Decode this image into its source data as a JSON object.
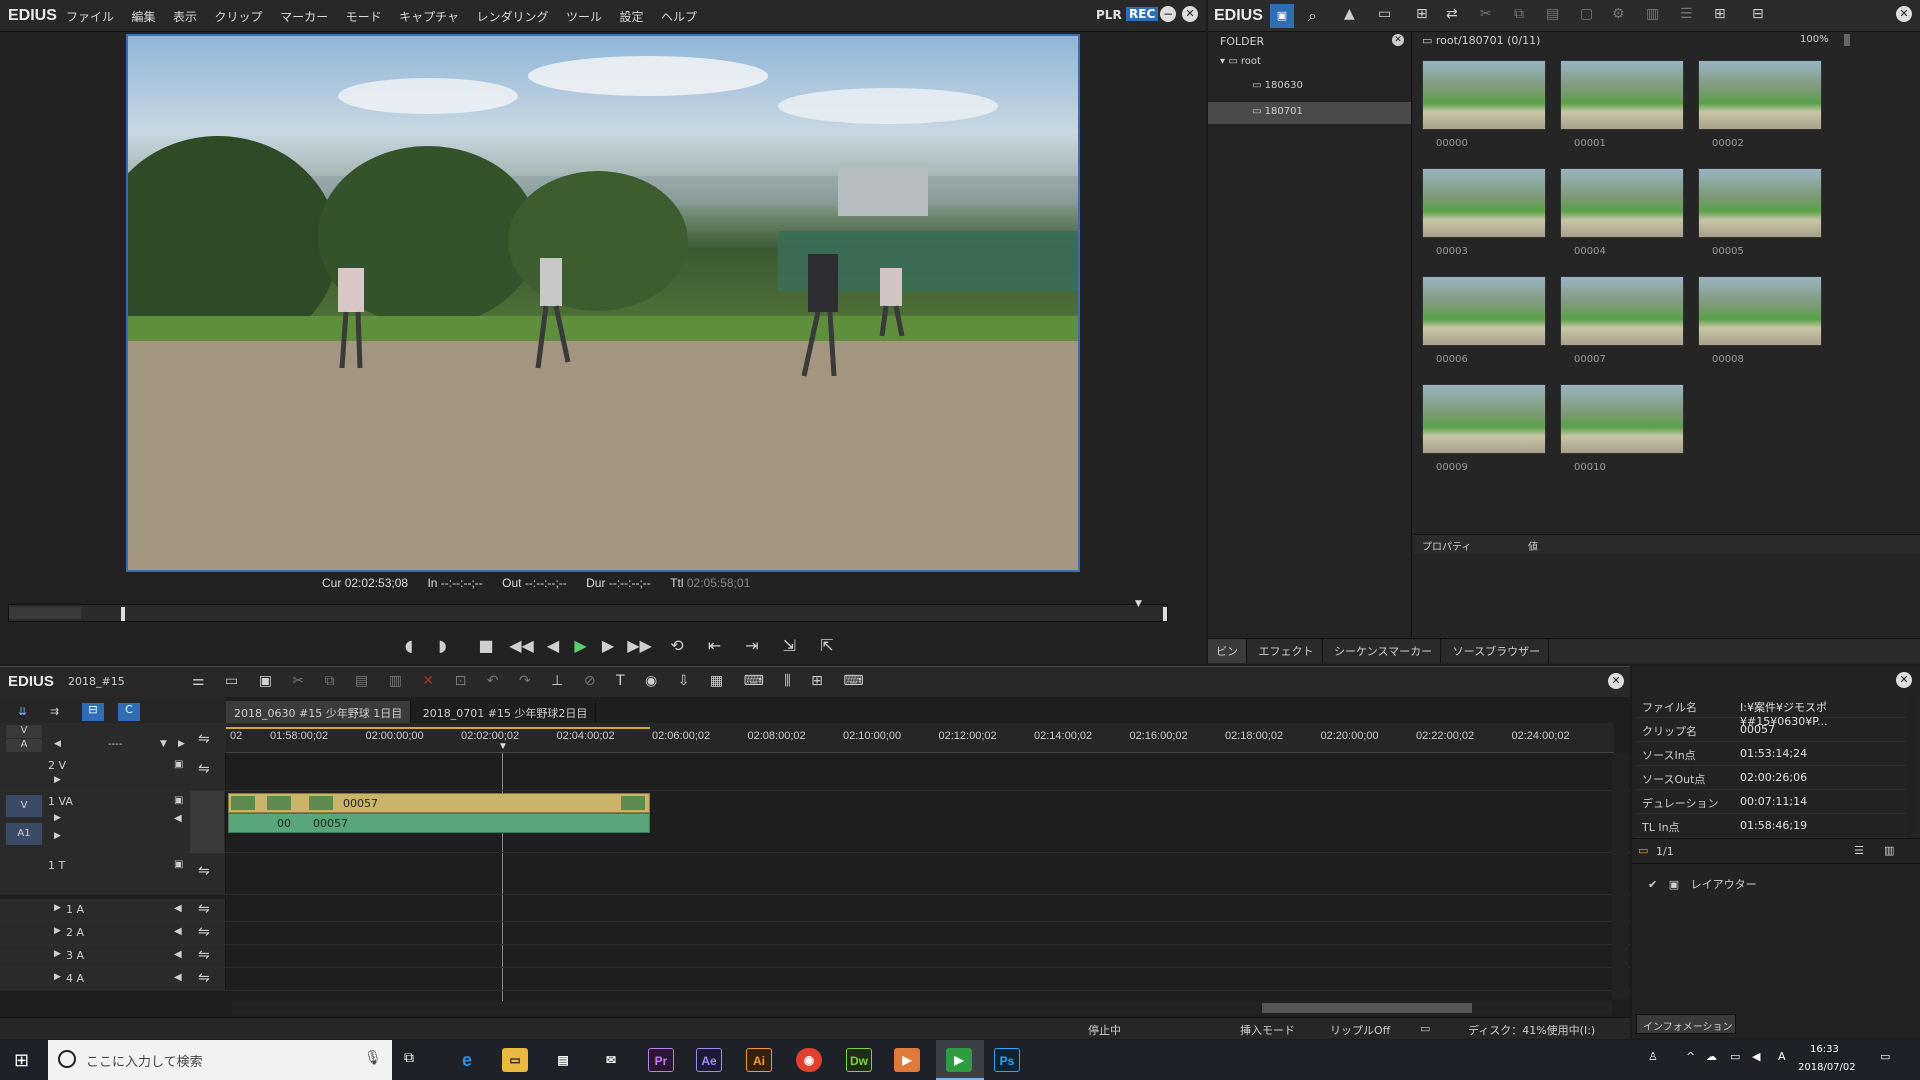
{
  "player": {
    "logo": "EDIUS",
    "menu": [
      "ファイル",
      "編集",
      "表示",
      "クリップ",
      "マーカー",
      "モード",
      "キャプチャ",
      "レンダリング",
      "ツール",
      "設定",
      "ヘルプ"
    ],
    "plr": "PLR",
    "rec": "REC",
    "cur_label": "Cur",
    "cur": "02:02:53;08",
    "in_label": "In",
    "in": "--:--:--;--",
    "out_label": "Out",
    "out": "--:--:--;--",
    "dur_label": "Dur",
    "dur": "--:--:--;--",
    "ttl_label": "Ttl",
    "ttl": "02:05:58;01"
  },
  "bin": {
    "logo": "EDIUS",
    "folder_header": "FOLDER",
    "tree": {
      "root": "root",
      "f1": "180630",
      "f2": "180701"
    },
    "path": "root/180701 (0/11)",
    "zoom": "100%",
    "clips": [
      "00000",
      "00001",
      "00002",
      "00003",
      "00004",
      "00005",
      "00006",
      "00007",
      "00008",
      "00009",
      "00010"
    ],
    "prop_col": "プロパティ",
    "val_col": "値",
    "tabs": [
      "ビン",
      "エフェクト",
      "シーケンスマーカー",
      "ソースブラウザー"
    ]
  },
  "timeline": {
    "logo": "EDIUS",
    "project": "2018_#15",
    "seq_tabs": [
      "2018_0630 #15 少年野球 1日目",
      "2018_0701 #15 少年野球2日目"
    ],
    "ruler": [
      "02",
      "01:58:00;02",
      "02:00:00;00",
      "02:02:00;02",
      "02:04:00;02",
      "02:06:00;02",
      "02:08:00;02",
      "02:10:00;00",
      "02:12:00;02",
      "02:14:00;02",
      "02:16:00;02",
      "02:18:00;02",
      "02:20:00;00",
      "02:22:00;02",
      "02:24:00;02"
    ],
    "tracks": {
      "v2": "2 V",
      "va1": "1 VA",
      "t1": "1 T",
      "a1": "1 A",
      "a2": "2 A",
      "a3": "3 A",
      "a4": "4 A",
      "v": "V",
      "a": "A"
    },
    "track_select": "----",
    "clip_v": "00057",
    "clip_a": "00057",
    "clip_a_small": "00",
    "status": {
      "state": "停止中",
      "mode": "挿入モード",
      "ripple": "リップルOff",
      "disk": "ディスク：41%使用中(I:)"
    }
  },
  "info": {
    "rows": [
      {
        "k": "ファイル名",
        "v": "I:¥案件¥ジモスポ¥#15¥0630¥P..."
      },
      {
        "k": "クリップ名",
        "v": "00057"
      },
      {
        "k": "ソースIn点",
        "v": "01:53:14;24"
      },
      {
        "k": "ソースOut点",
        "v": "02:00:26;06"
      },
      {
        "k": "デュレーション",
        "v": "00:07:11;14"
      },
      {
        "k": "TL In点",
        "v": "01:58:46;19"
      }
    ],
    "layer_count": "1/1",
    "layer": "レイアウター",
    "tab": "インフォメーション"
  },
  "taskbar": {
    "search": "ここに入力して検索",
    "apps": [
      "Pr",
      "Ae",
      "Ai",
      "Dw",
      "Ps"
    ],
    "time": "16:33",
    "date": "2018/07/02",
    "ime": "A"
  }
}
